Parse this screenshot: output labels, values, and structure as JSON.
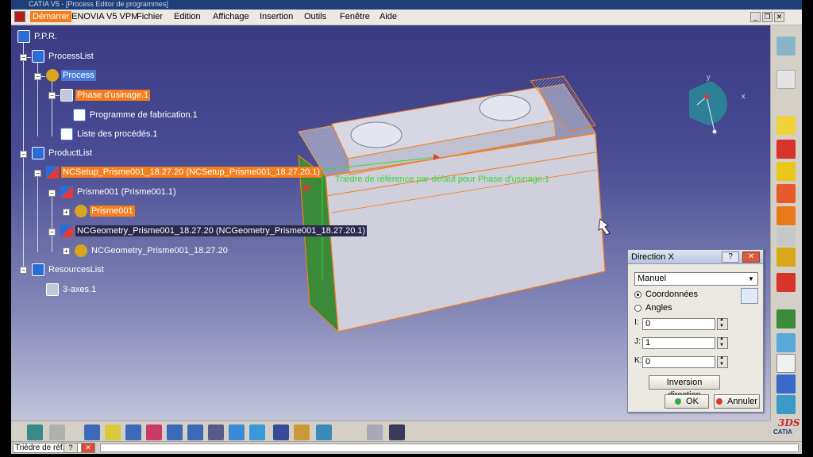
{
  "window": {
    "title": "CATIA V5 - [Process Editor de programmes]"
  },
  "menubar": {
    "start": "Démarrer",
    "items": [
      "ENOVIA V5 VPM",
      "Fichier",
      "Edition",
      "Affichage",
      "Insertion",
      "Outils",
      "Fenêtre",
      "Aide"
    ]
  },
  "tree": {
    "root": "P.P.R.",
    "process_list": "ProcessList",
    "process": "Process",
    "phase": "Phase d'usinage.1",
    "program": "Programme de fabrication.1",
    "procedures": "Liste des procédés.1",
    "product_list": "ProductList",
    "nc_setup": "NCSetup_Prisme001_18.27.20 (NCSetup_Prisme001_18.27.20.1)",
    "prisme_instance": "Prisme001 (Prisme001.1)",
    "prisme_part": "Prisme001",
    "nc_geometry": "NCGeometry_Prisme001_18.27.20 (NCGeometry_Prisme001_18.27.20.1)",
    "nc_geometry_part": "NCGeometry_Prisme001_18.27.20",
    "resources_list": "ResourcesList",
    "machine": "3-axes.1"
  },
  "viewport": {
    "axis_annotation": "Trièdre de référence par défaut pour Phase d'usinage.1",
    "compass_x": "x",
    "compass_y": "y"
  },
  "dialog": {
    "title": "Direction X",
    "help_label": "?",
    "close_label": "✕",
    "mode_value": "Manuel",
    "radio_coordinates": "Coordonnées",
    "radio_angles": "Angles",
    "i_label": "I:",
    "i_value": "0",
    "j_label": "J:",
    "j_value": "1",
    "k_label": "K:",
    "k_value": "0",
    "invert_button": "Inversion direction",
    "ok_button": "OK",
    "cancel_button": "Annuler"
  },
  "status": {
    "prompt": "Trièdre de réf..."
  },
  "logo": {
    "brand": "CATIA",
    "mark": "3DS"
  },
  "colors": {
    "highlight_orange": "#f47e1c",
    "highlight_blue": "#4a7ad8",
    "part_edges": "#f47e1c",
    "annotation_green": "#38d838"
  }
}
